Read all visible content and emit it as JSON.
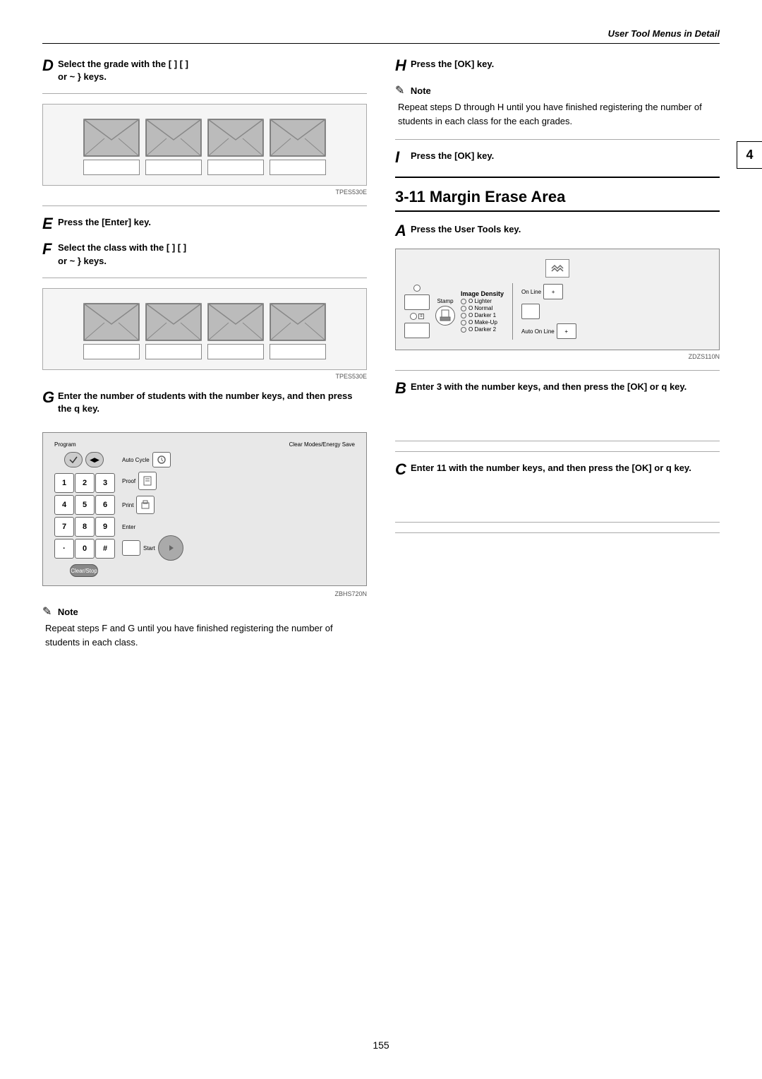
{
  "header": {
    "title": "User Tool Menus in Detail"
  },
  "page_number": "155",
  "tab_number": "4",
  "section_heading": "3-11 Margin Erase Area",
  "steps": {
    "D": {
      "letter": "D",
      "text": "Select the grade with the [  ] [  ]",
      "text2": "or  ~  }  keys."
    },
    "E": {
      "letter": "E",
      "text": "Press the [Enter] key."
    },
    "F": {
      "letter": "F",
      "text": "Select the class with the [  ] [  ]",
      "text2": "or  ~  }  keys."
    },
    "G": {
      "letter": "G",
      "text": "Enter the number of students with the number keys, and then press the  q  key."
    },
    "note_fg": {
      "symbol": "✎",
      "label": "Note",
      "text": "Repeat steps F and G until you have finished registering the number of students in each class."
    },
    "H": {
      "letter": "H",
      "text": "Press the [OK] key."
    },
    "note_h": {
      "symbol": "✎",
      "label": "Note",
      "text": "Repeat steps D through H until you have finished registering the number of students in each class for the each grades."
    },
    "I": {
      "letter": "I",
      "text": "Press the [OK] key."
    },
    "A_right": {
      "letter": "A",
      "text": "Press the  User Tools key."
    },
    "B_right": {
      "letter": "B",
      "text": "Enter 3 with the number keys, and then press the [OK] or  q  key."
    },
    "C_right": {
      "letter": "C",
      "text": "Enter 11 with the number keys, and then press the [OK] or  q  key."
    }
  },
  "image_labels": {
    "tpes530e_1": "TPES530E",
    "tpes530e_2": "TPES530E",
    "zbhs720n": "ZBHS720N",
    "zdzs110n": "ZDZS110N"
  },
  "keypad": {
    "program": "Program",
    "clear_modes": "Clear Modes/Energy Save",
    "auto_cycle": "Auto Cycle",
    "proof": "Proof",
    "print": "Print",
    "enter": "Enter",
    "start": "Start",
    "clear_stop": "Clear/Stop",
    "keys": [
      "1",
      "2",
      "3",
      "4",
      "5",
      "6",
      "7",
      "8",
      "9",
      "·",
      "0",
      "#"
    ]
  },
  "control_panel": {
    "stamp_label": "Stamp",
    "image_density": "Image Density",
    "lighter": "O Lighter",
    "normal": "O Normal",
    "darker1": "O Darker 1",
    "makeup": "O Make-Up",
    "darker2": "O Darker 2",
    "online": "On Line",
    "auto_online": "Auto On Line"
  }
}
